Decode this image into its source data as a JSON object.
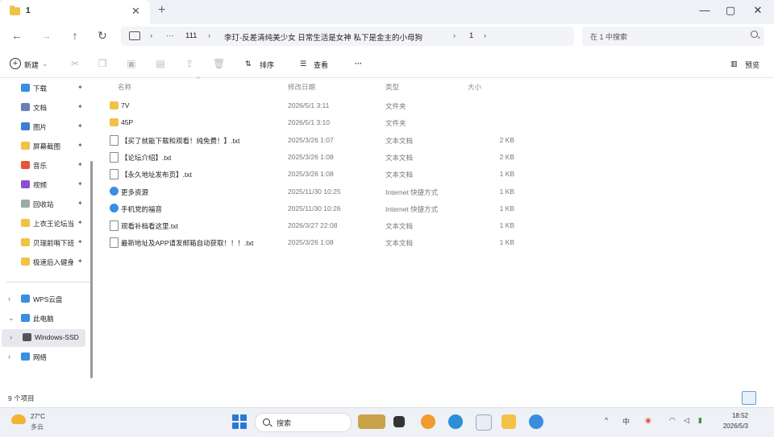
{
  "window": {
    "tab_title": "1",
    "new_tab": "+",
    "minimize": "—",
    "maximize": "▢",
    "close": "✕"
  },
  "nav": {
    "back": "←",
    "forward": "→",
    "up": "↑",
    "refresh": "↻"
  },
  "breadcrumb": {
    "more": "···",
    "items": [
      "111",
      "李玎-反差清纯美少女 日常生活是女神 私下是金主的小母狗",
      "1"
    ],
    "sep": "›"
  },
  "search": {
    "placeholder": "在 1 中搜索"
  },
  "toolbar": {
    "new_label": "新建",
    "sort_label": "排序",
    "view_label": "查看",
    "more_label": "···",
    "details_label": "预览"
  },
  "sidebar": {
    "quick": [
      {
        "label": "下载",
        "icon": "download-icon",
        "color": "#3b8de0"
      },
      {
        "label": "文档",
        "icon": "document-icon",
        "color": "#6a7fb8"
      },
      {
        "label": "图片",
        "icon": "picture-icon",
        "color": "#3a7fd0"
      },
      {
        "label": "屏幕截图",
        "icon": "folder-icon",
        "color": "#f1c244"
      },
      {
        "label": "音乐",
        "icon": "music-icon",
        "color": "#e5543c"
      },
      {
        "label": "视频",
        "icon": "video-icon",
        "color": "#8a4fd0"
      },
      {
        "label": "回收站",
        "icon": "recycle-bin-icon",
        "color": "#9aa"
      },
      {
        "label": "上衣王论坛当",
        "icon": "folder-icon",
        "color": "#f1c244"
      },
      {
        "label": "贝瑞前哨下班",
        "icon": "folder-icon",
        "color": "#f1c244"
      },
      {
        "label": "极速后入健身",
        "icon": "folder-icon",
        "color": "#f1c244"
      }
    ],
    "pin": "📌",
    "tree": [
      {
        "label": "WPS云盘",
        "icon": "cloud-icon",
        "color": "#3b8de0"
      },
      {
        "label": "此电脑",
        "icon": "computer-icon",
        "color": "#3b8de0"
      },
      {
        "label": "Windows-SSD",
        "icon": "drive-icon",
        "color": "#555"
      },
      {
        "label": "网络",
        "icon": "network-icon",
        "color": "#3b8de0"
      }
    ]
  },
  "columns": {
    "name": "名称",
    "date": "修改日期",
    "type": "类型",
    "size": "大小"
  },
  "files": [
    {
      "name": "7V",
      "date": "2026/5/1 3:11",
      "type": "文件夹",
      "size": "",
      "icon": "folder-icon"
    },
    {
      "name": "45P",
      "date": "2026/5/1 3:10",
      "type": "文件夹",
      "size": "",
      "icon": "folder-icon"
    },
    {
      "name": "【买了就能下载和观看！纯免费！】.txt",
      "date": "2025/3/26 1:07",
      "type": "文本文档",
      "size": "2 KB",
      "icon": "text-file-icon"
    },
    {
      "name": "【论坛介绍】.txt",
      "date": "2025/3/26 1:08",
      "type": "文本文档",
      "size": "2 KB",
      "icon": "text-file-icon"
    },
    {
      "name": "【永久地址发布页】.txt",
      "date": "2025/3/26 1:08",
      "type": "文本文档",
      "size": "1 KB",
      "icon": "text-file-icon"
    },
    {
      "name": "更多资源",
      "date": "2025/11/30 10:25",
      "type": "Internet 快捷方式",
      "size": "1 KB",
      "icon": "internet-shortcut-icon"
    },
    {
      "name": "手机党的福音",
      "date": "2025/11/30 10:26",
      "type": "Internet 快捷方式",
      "size": "1 KB",
      "icon": "internet-shortcut-icon"
    },
    {
      "name": "观看补档看这里.txt",
      "date": "2026/3/27 22:08",
      "type": "文本文档",
      "size": "1 KB",
      "icon": "text-file-icon"
    },
    {
      "name": "最新地址及APP请发邮箱自动获取！！！.txt",
      "date": "2025/3/26 1:08",
      "type": "文本文档",
      "size": "1 KB",
      "icon": "text-file-icon"
    }
  ],
  "status": {
    "count": "9 个项目"
  },
  "taskbar": {
    "temperature": "27°C",
    "weather": "多云",
    "search_placeholder": "搜索",
    "time": "18:52",
    "date": "2026/5/3",
    "tray_items": [
      "^",
      "中",
      "wifi",
      "volume",
      "battery"
    ]
  }
}
